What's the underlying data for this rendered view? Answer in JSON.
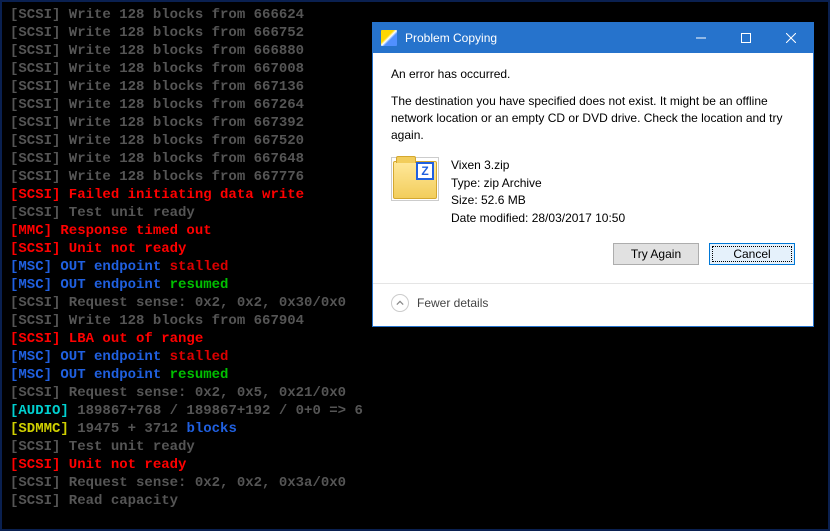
{
  "terminal": {
    "lines": [
      [
        {
          "c": "dim",
          "t": "[SCSI] Write 128 blocks from 666624"
        }
      ],
      [
        {
          "c": "dim",
          "t": "[SCSI] Write 128 blocks from 666752"
        }
      ],
      [
        {
          "c": "dim",
          "t": "[SCSI] Write 128 blocks from 666880"
        }
      ],
      [
        {
          "c": "dim",
          "t": "[SCSI] Write 128 blocks from 667008"
        }
      ],
      [
        {
          "c": "dim",
          "t": "[SCSI] Write 128 blocks from 667136"
        }
      ],
      [
        {
          "c": "dim",
          "t": "[SCSI] Write 128 blocks from 667264"
        }
      ],
      [
        {
          "c": "dim",
          "t": "[SCSI] Write 128 blocks from 667392"
        }
      ],
      [
        {
          "c": "dim",
          "t": "[SCSI] Write 128 blocks from 667520"
        }
      ],
      [
        {
          "c": "dim",
          "t": "[SCSI] Write 128 blocks from 667648"
        }
      ],
      [
        {
          "c": "dim",
          "t": "[SCSI] Write 128 blocks from 667776"
        }
      ],
      [
        {
          "c": "bold-red",
          "t": "[SCSI] Failed initiating data write"
        }
      ],
      [
        {
          "c": "dim",
          "t": "[SCSI] Test unit ready"
        }
      ],
      [
        {
          "c": "bold-red",
          "t": "[MMC] Response timed out"
        }
      ],
      [
        {
          "c": "bold-red",
          "t": "[SCSI] Unit not ready"
        }
      ],
      [
        {
          "c": "blue",
          "t": "[MSC] OUT endpoint "
        },
        {
          "c": "red",
          "t": "stalled"
        }
      ],
      [
        {
          "c": "blue",
          "t": "[MSC] OUT endpoint "
        },
        {
          "c": "green",
          "t": "resumed"
        }
      ],
      [
        {
          "c": "dim",
          "t": "[SCSI] Request sense: 0x2, 0x2, 0x30/0x0"
        }
      ],
      [
        {
          "c": "dim",
          "t": "[SCSI] Write 128 blocks from 667904"
        }
      ],
      [
        {
          "c": "bold-red",
          "t": "[SCSI] LBA out of range"
        }
      ],
      [
        {
          "c": "blue",
          "t": "[MSC] OUT endpoint "
        },
        {
          "c": "red",
          "t": "stalled"
        }
      ],
      [
        {
          "c": "blue",
          "t": "[MSC] OUT endpoint "
        },
        {
          "c": "green",
          "t": "resumed"
        }
      ],
      [
        {
          "c": "dim",
          "t": "[SCSI] Request sense: 0x2, 0x5, 0x21/0x0"
        }
      ],
      [
        {
          "c": "cyan",
          "t": "[AUDIO] "
        },
        {
          "c": "dim",
          "t": "189867+768 / 189867+192 / 0+0 => 6"
        }
      ],
      [
        {
          "c": "yellow",
          "t": "[SDMMC] "
        },
        {
          "c": "dim",
          "t": "19475 + 3712 "
        },
        {
          "c": "blue",
          "t": "blocks"
        }
      ],
      [
        {
          "c": "dim",
          "t": "[SCSI] Test unit ready"
        }
      ],
      [
        {
          "c": "bold-red",
          "t": "[SCSI] Unit not ready"
        }
      ],
      [
        {
          "c": "dim",
          "t": "[SCSI] Request sense: 0x2, 0x2, 0x3a/0x0"
        }
      ],
      [
        {
          "c": "dim",
          "t": "[SCSI] Read capacity"
        }
      ]
    ]
  },
  "dialog": {
    "title": "Problem Copying",
    "heading": "An error has occurred.",
    "message": "The destination you have specified does not exist. It might be an offline network location or an empty CD or DVD drive. Check the location and try again.",
    "file": {
      "name": "Vixen 3.zip",
      "type_label": "Type: zip Archive",
      "size_label": "Size: 52.6 MB",
      "modified_label": "Date modified: 28/03/2017 10:50",
      "zip_badge": "Z"
    },
    "buttons": {
      "try_again": "Try Again",
      "cancel": "Cancel"
    },
    "footer": {
      "fewer_details": "Fewer details"
    }
  }
}
